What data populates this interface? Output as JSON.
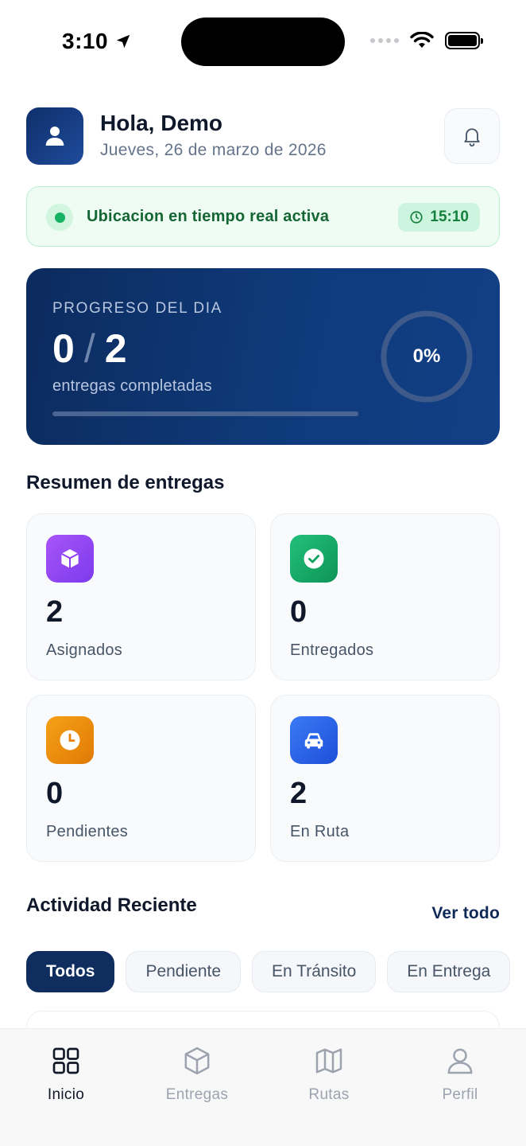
{
  "status_bar": {
    "time": "3:10"
  },
  "header": {
    "greeting": "Hola, Demo",
    "date": "Jueves, 26 de marzo de 2026"
  },
  "location_banner": {
    "text": "Ubicacion en tiempo real activa",
    "time": "15:10"
  },
  "progress": {
    "label": "PROGRESO DEL DIA",
    "completed": "0",
    "separator": "/",
    "total": "2",
    "subtitle": "entregas completadas",
    "percent_label": "0%",
    "percent": 0
  },
  "summary": {
    "title": "Resumen de entregas",
    "cards": [
      {
        "value": "2",
        "label": "Asignados",
        "icon": "box-icon",
        "color": "#8b3ff0"
      },
      {
        "value": "0",
        "label": "Entregados",
        "icon": "check-circle-icon",
        "color": "#10a060"
      },
      {
        "value": "0",
        "label": "Pendientes",
        "icon": "clock-icon",
        "color": "#e8820c"
      },
      {
        "value": "2",
        "label": "En Ruta",
        "icon": "car-icon",
        "color": "#2563eb"
      }
    ]
  },
  "activity": {
    "title": "Actividad Reciente",
    "see_all": "Ver todo",
    "filters": [
      "Todos",
      "Pendiente",
      "En Tránsito",
      "En Entrega"
    ],
    "active_filter": "Todos"
  },
  "tab_bar": {
    "tabs": [
      {
        "label": "Inicio",
        "icon": "grid-icon",
        "active": true
      },
      {
        "label": "Entregas",
        "icon": "package-icon",
        "active": false
      },
      {
        "label": "Rutas",
        "icon": "map-icon",
        "active": false
      },
      {
        "label": "Perfil",
        "icon": "user-icon",
        "active": false
      }
    ]
  }
}
